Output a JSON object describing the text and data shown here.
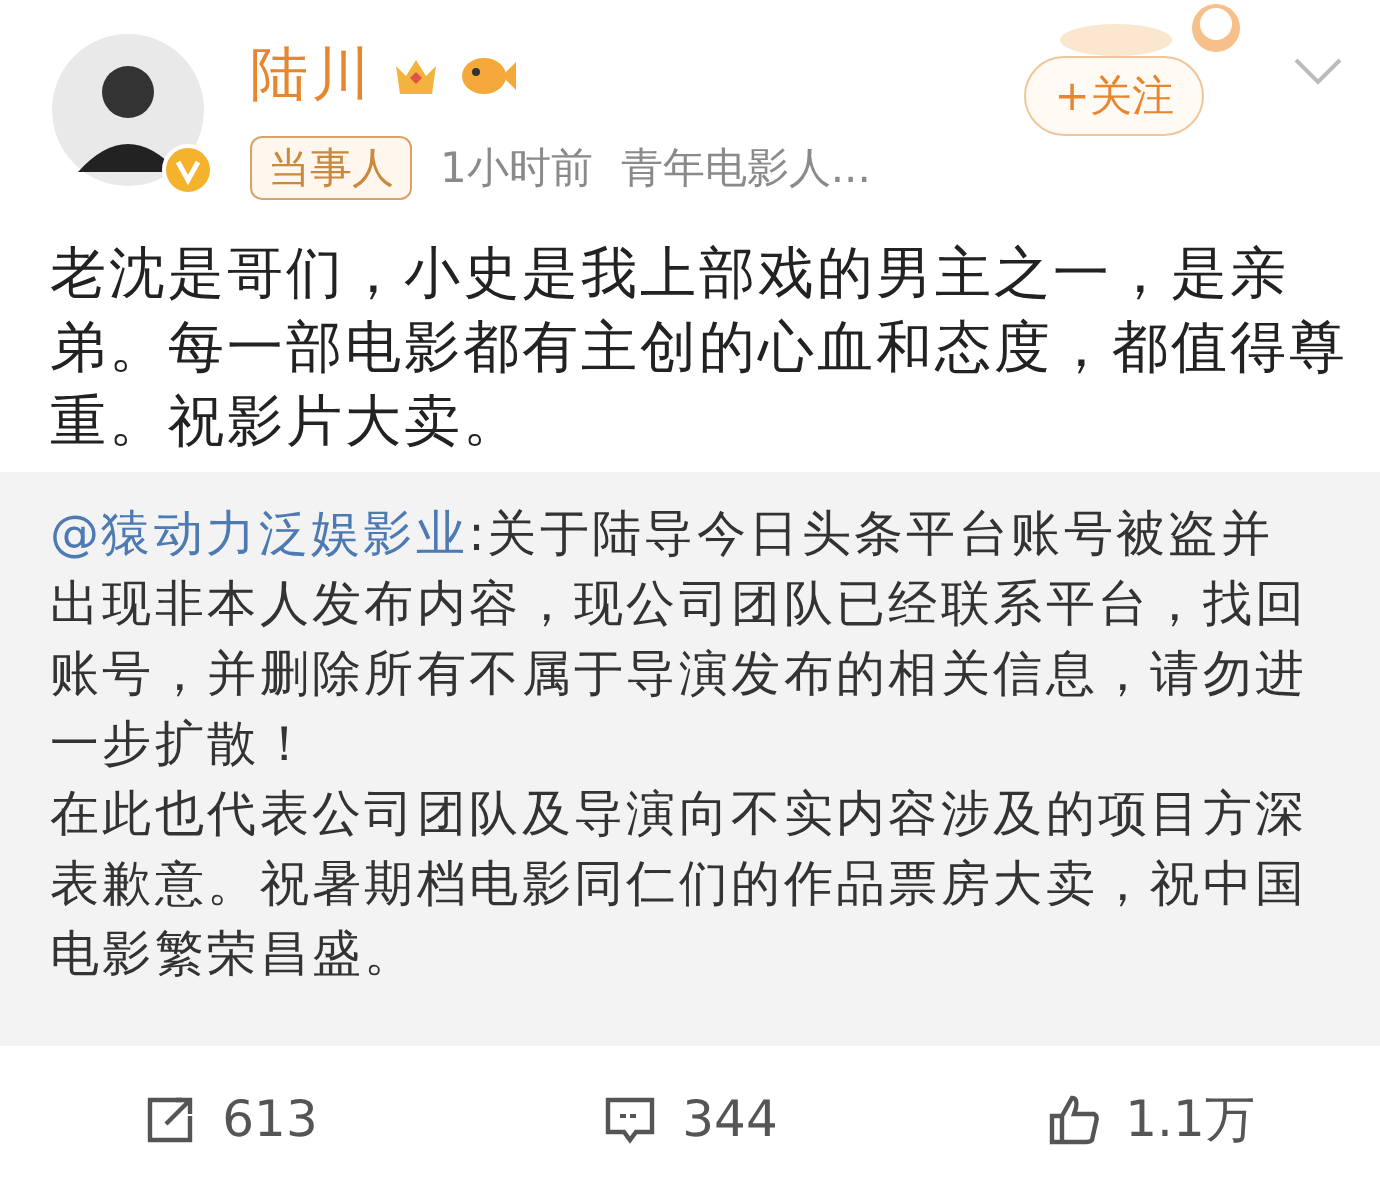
{
  "author": {
    "name": "陆川",
    "tag": "当事人",
    "time": "1小时前",
    "source": "青年电影人...",
    "follow_button": "+关注",
    "verified": true
  },
  "post": {
    "lines": [
      "老沈是哥们，小史是我上部戏的男主之一，是亲",
      "弟。每一部电影都有主创的心血和态度，都值得尊",
      "重。祝影片大卖。"
    ]
  },
  "repost": {
    "mention": "@猿动力泛娱影业",
    "lines": [
      ":关于陆导今日头条平台账号被盗并",
      "出现非本人发布内容，现公司团队已经联系平台，找回",
      "账号，并删除所有不属于导演发布的相关信息，请勿进",
      "一步扩散！",
      "在此也代表公司团队及导演向不实内容涉及的项目方深",
      "表歉意。祝暑期档电影同仁们的作品票房大卖，祝中国",
      "电影繁荣昌盛。"
    ]
  },
  "actions": [
    {
      "kind": "share",
      "count": "613"
    },
    {
      "kind": "comment",
      "count": "344"
    },
    {
      "kind": "like",
      "count": "1.1万"
    }
  ]
}
